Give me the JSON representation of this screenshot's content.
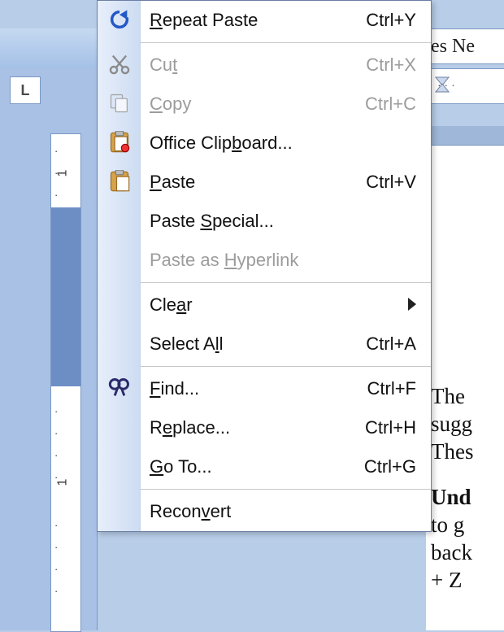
{
  "font_selector_visible_text": "es Ne",
  "ruler_corner": "L",
  "doc_fragment": {
    "l1": "The",
    "l2": "sugg",
    "l3": "Thes",
    "l4_bold": "Und",
    "l5": "to g",
    "l6": "back",
    "l7": "+ Z"
  },
  "menu": {
    "items": [
      {
        "id": "repeat-paste",
        "label": "Repeat Paste",
        "u": 0,
        "kbd": "Ctrl+Y",
        "icon": "repeat-icon",
        "enabled": true,
        "submenu": false,
        "sep_after": true
      },
      {
        "id": "cut",
        "label": "Cut",
        "u": 2,
        "kbd": "Ctrl+X",
        "icon": "cut-icon",
        "enabled": false,
        "submenu": false,
        "sep_after": false
      },
      {
        "id": "copy",
        "label": "Copy",
        "u": 0,
        "kbd": "Ctrl+C",
        "icon": "copy-icon",
        "enabled": false,
        "submenu": false,
        "sep_after": false
      },
      {
        "id": "office-clip",
        "label": "Office Clipboard...",
        "u": 11,
        "kbd": "",
        "icon": "clipboard-icon",
        "enabled": true,
        "submenu": false,
        "sep_after": false
      },
      {
        "id": "paste",
        "label": "Paste",
        "u": 0,
        "kbd": "Ctrl+V",
        "icon": "paste-icon",
        "enabled": true,
        "submenu": false,
        "sep_after": false
      },
      {
        "id": "paste-special",
        "label": "Paste Special...",
        "u": 6,
        "kbd": "",
        "icon": "",
        "enabled": true,
        "submenu": false,
        "sep_after": false
      },
      {
        "id": "paste-link",
        "label": "Paste as Hyperlink",
        "u": 9,
        "kbd": "",
        "icon": "",
        "enabled": false,
        "submenu": false,
        "sep_after": true
      },
      {
        "id": "clear",
        "label": "Clear",
        "u": 3,
        "kbd": "",
        "icon": "",
        "enabled": true,
        "submenu": true,
        "sep_after": false
      },
      {
        "id": "select-all",
        "label": "Select All",
        "u": 8,
        "kbd": "Ctrl+A",
        "icon": "",
        "enabled": true,
        "submenu": false,
        "sep_after": true
      },
      {
        "id": "find",
        "label": "Find...",
        "u": 0,
        "kbd": "Ctrl+F",
        "icon": "find-icon",
        "enabled": true,
        "submenu": false,
        "sep_after": false
      },
      {
        "id": "replace",
        "label": "Replace...",
        "u": 1,
        "kbd": "Ctrl+H",
        "icon": "",
        "enabled": true,
        "submenu": false,
        "sep_after": false
      },
      {
        "id": "goto",
        "label": "Go To...",
        "u": 0,
        "kbd": "Ctrl+G",
        "icon": "",
        "enabled": true,
        "submenu": false,
        "sep_after": true
      },
      {
        "id": "reconvert",
        "label": "Reconvert",
        "u": 5,
        "kbd": "",
        "icon": "",
        "enabled": true,
        "submenu": false,
        "sep_after": false
      }
    ]
  },
  "vruler_num": "1"
}
